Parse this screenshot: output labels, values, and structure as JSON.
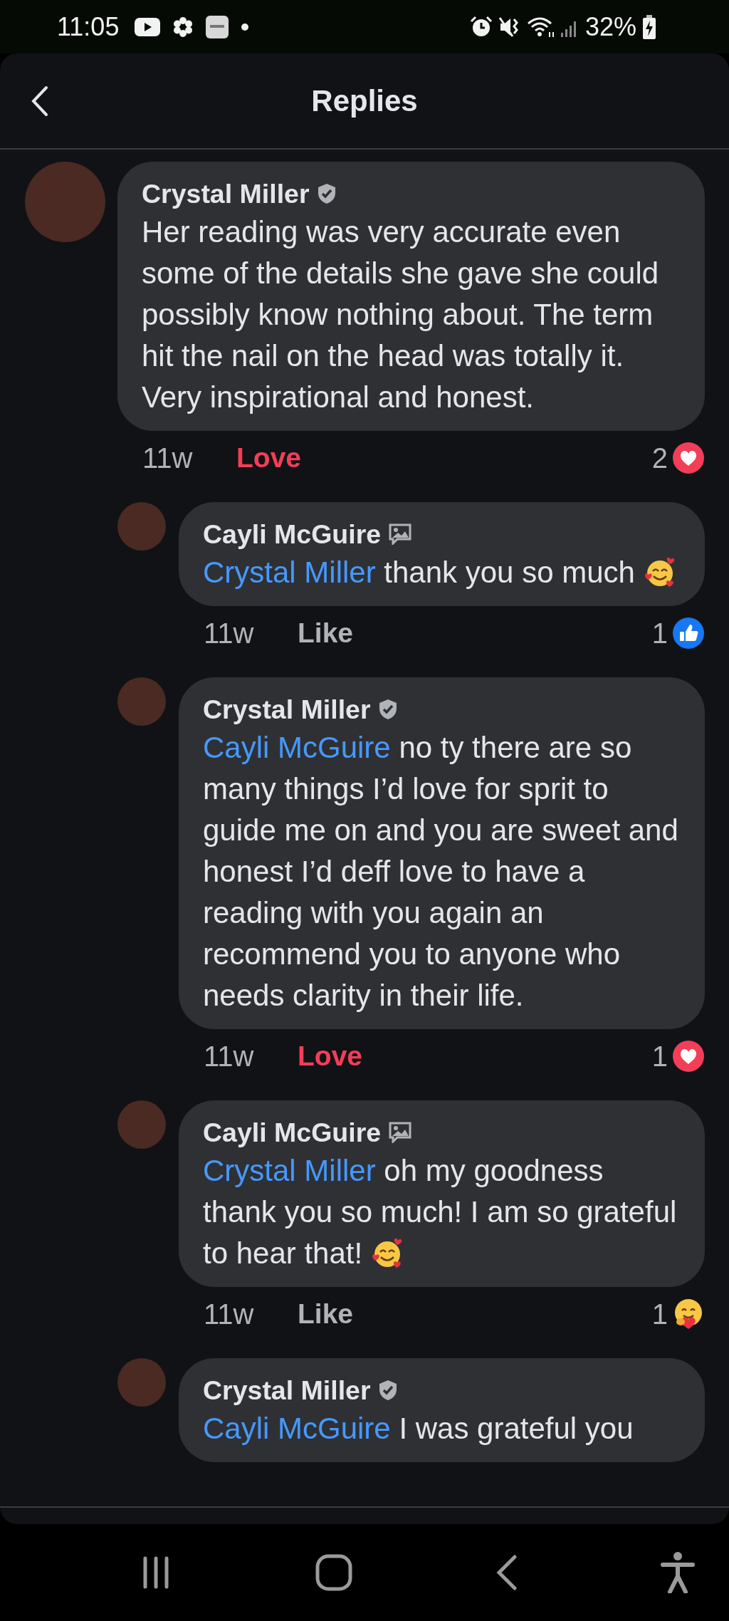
{
  "status_bar": {
    "time": "11:05",
    "battery": "32%"
  },
  "header": {
    "title": "Replies"
  },
  "comments": [
    {
      "author": "Crystal Miller",
      "badge": {
        "kind": "verified"
      },
      "body": [
        {
          "kind": "text",
          "text": "Her reading was very accurate even some of the details she gave she could possibly know nothing about. The term hit the nail on the head was totally it. Very inspirational and honest."
        }
      ],
      "age": "11w",
      "action": {
        "label": "Love",
        "kind": "love"
      },
      "reaction": {
        "count": "2",
        "kind": "love"
      },
      "replies": [
        {
          "author": "Cayli McGuire",
          "badge": {
            "kind": "picture"
          },
          "body": [
            {
              "kind": "mention",
              "text": "Crystal Miller"
            },
            {
              "kind": "text",
              "text": " thank you so much "
            },
            {
              "kind": "emoji"
            }
          ],
          "age": "11w",
          "action": {
            "label": "Like",
            "kind": "like"
          },
          "reaction": {
            "count": "1",
            "kind": "like"
          }
        },
        {
          "author": "Crystal Miller",
          "badge": {
            "kind": "verified"
          },
          "body": [
            {
              "kind": "mention",
              "text": "Cayli McGuire"
            },
            {
              "kind": "text",
              "text": "  no ty there are so many things I’d love for sprit to guide me on and you are sweet and honest I’d deff love to have a reading with you again an recommend you to anyone who needs clarity in their life."
            }
          ],
          "age": "11w",
          "action": {
            "label": "Love",
            "kind": "love"
          },
          "reaction": {
            "count": "1",
            "kind": "love"
          }
        },
        {
          "author": "Cayli McGuire",
          "badge": {
            "kind": "picture"
          },
          "body": [
            {
              "kind": "mention",
              "text": "Crystal Miller"
            },
            {
              "kind": "text",
              "text": " oh my goodness thank you so much! I am so grateful to hear that! "
            },
            {
              "kind": "emoji"
            }
          ],
          "age": "11w",
          "action": {
            "label": "Like",
            "kind": "like"
          },
          "reaction": {
            "count": "1",
            "kind": "care"
          }
        },
        {
          "author": "Crystal Miller",
          "badge": {
            "kind": "verified"
          },
          "body": [
            {
              "kind": "mention",
              "text": "Cayli McGuire"
            },
            {
              "kind": "text",
              "text": "  I was grateful you"
            }
          ]
        }
      ]
    }
  ]
}
